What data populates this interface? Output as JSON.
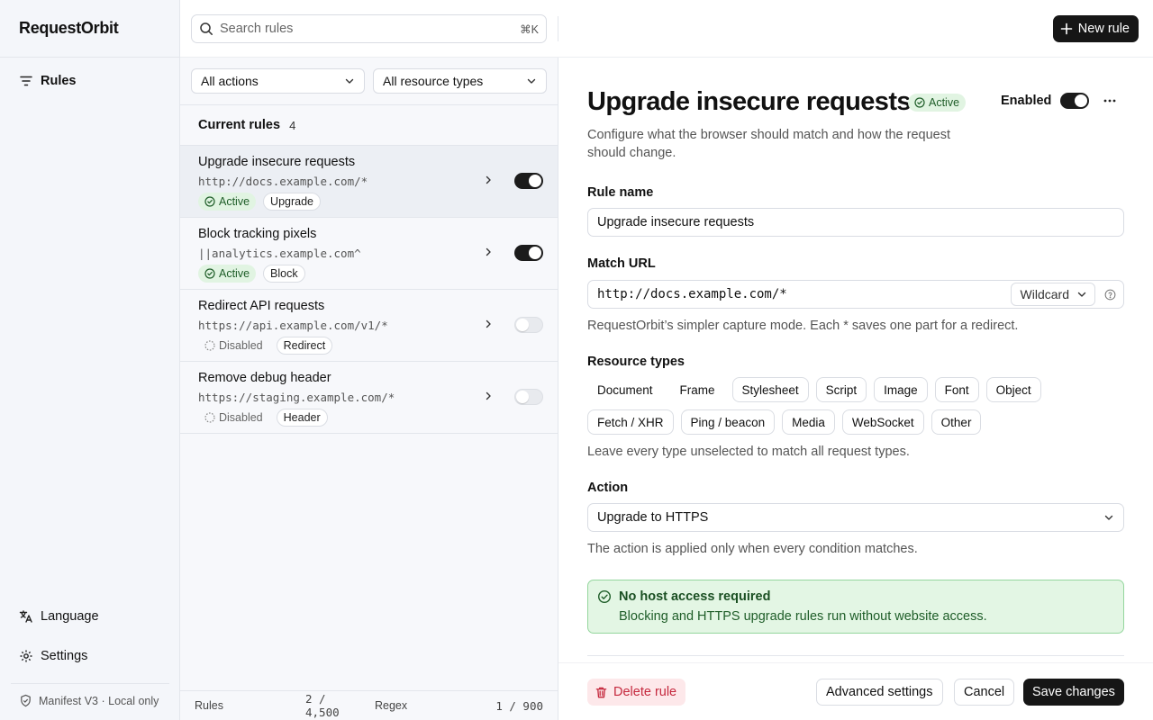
{
  "app": {
    "name": "RequestOrbit"
  },
  "sidebar": {
    "nav": {
      "rules": "Rules",
      "language": "Language",
      "settings": "Settings"
    },
    "footer": "Manifest V3 · Local only"
  },
  "topbar": {
    "search_placeholder": "Search rules",
    "search_shortcut": "⌘K",
    "new_rule": "New rule"
  },
  "filters": {
    "actions": "All actions",
    "resource_types": "All resource types"
  },
  "rules_list": {
    "title": "Current rules",
    "count": "4",
    "items": [
      {
        "name": "Upgrade insecure requests",
        "url": "http://docs.example.com/*",
        "status": "Active",
        "action": "Upgrade",
        "enabled": true,
        "selected": true
      },
      {
        "name": "Block tracking pixels",
        "url": "||analytics.example.com^",
        "status": "Active",
        "action": "Block",
        "enabled": true,
        "selected": false
      },
      {
        "name": "Redirect API requests",
        "url": "https://api.example.com/v1/*",
        "status": "Disabled",
        "action": "Redirect",
        "enabled": false,
        "selected": false
      },
      {
        "name": "Remove debug header",
        "url": "https://staging.example.com/*",
        "status": "Disabled",
        "action": "Header",
        "enabled": false,
        "selected": false
      }
    ]
  },
  "status_bar": {
    "rules_label": "Rules",
    "rules_used": "2 / 4,500",
    "regex_label": "Regex",
    "regex_used": "1 / 900"
  },
  "detail": {
    "title": "Upgrade insecure requests",
    "status": "Active",
    "enabled_label": "Enabled",
    "enabled": true,
    "description": "Configure what the browser should match and how the request should change.",
    "rule_name_label": "Rule name",
    "rule_name_value": "Upgrade insecure requests",
    "match_url_label": "Match URL",
    "match_url_value": "http://docs.example.com/*",
    "match_mode": "Wildcard",
    "match_hint": "RequestOrbit’s simpler capture mode. Each * saves one part for a redirect.",
    "resource_types_label": "Resource types",
    "resource_types": [
      "Document",
      "Frame",
      "Stylesheet",
      "Script",
      "Image",
      "Font",
      "Object",
      "Fetch / XHR",
      "Ping / beacon",
      "Media",
      "WebSocket",
      "Other"
    ],
    "resource_hint": "Leave every type unselected to match all request types.",
    "action_label": "Action",
    "action_value": "Upgrade to HTTPS",
    "action_hint": "The action is applied only when every condition matches.",
    "notice": {
      "title": "No host access required",
      "body": "Blocking and HTTPS upgrade rules run without website access."
    }
  },
  "footer": {
    "delete": "Delete rule",
    "advanced": "Advanced settings",
    "cancel": "Cancel",
    "save": "Save changes"
  },
  "colors": {
    "accent": "#161616",
    "active_bg": "#e1f4e2",
    "active_fg": "#1e5d28",
    "danger": "#c5283d",
    "notice_bg": "#e3f6e4"
  }
}
